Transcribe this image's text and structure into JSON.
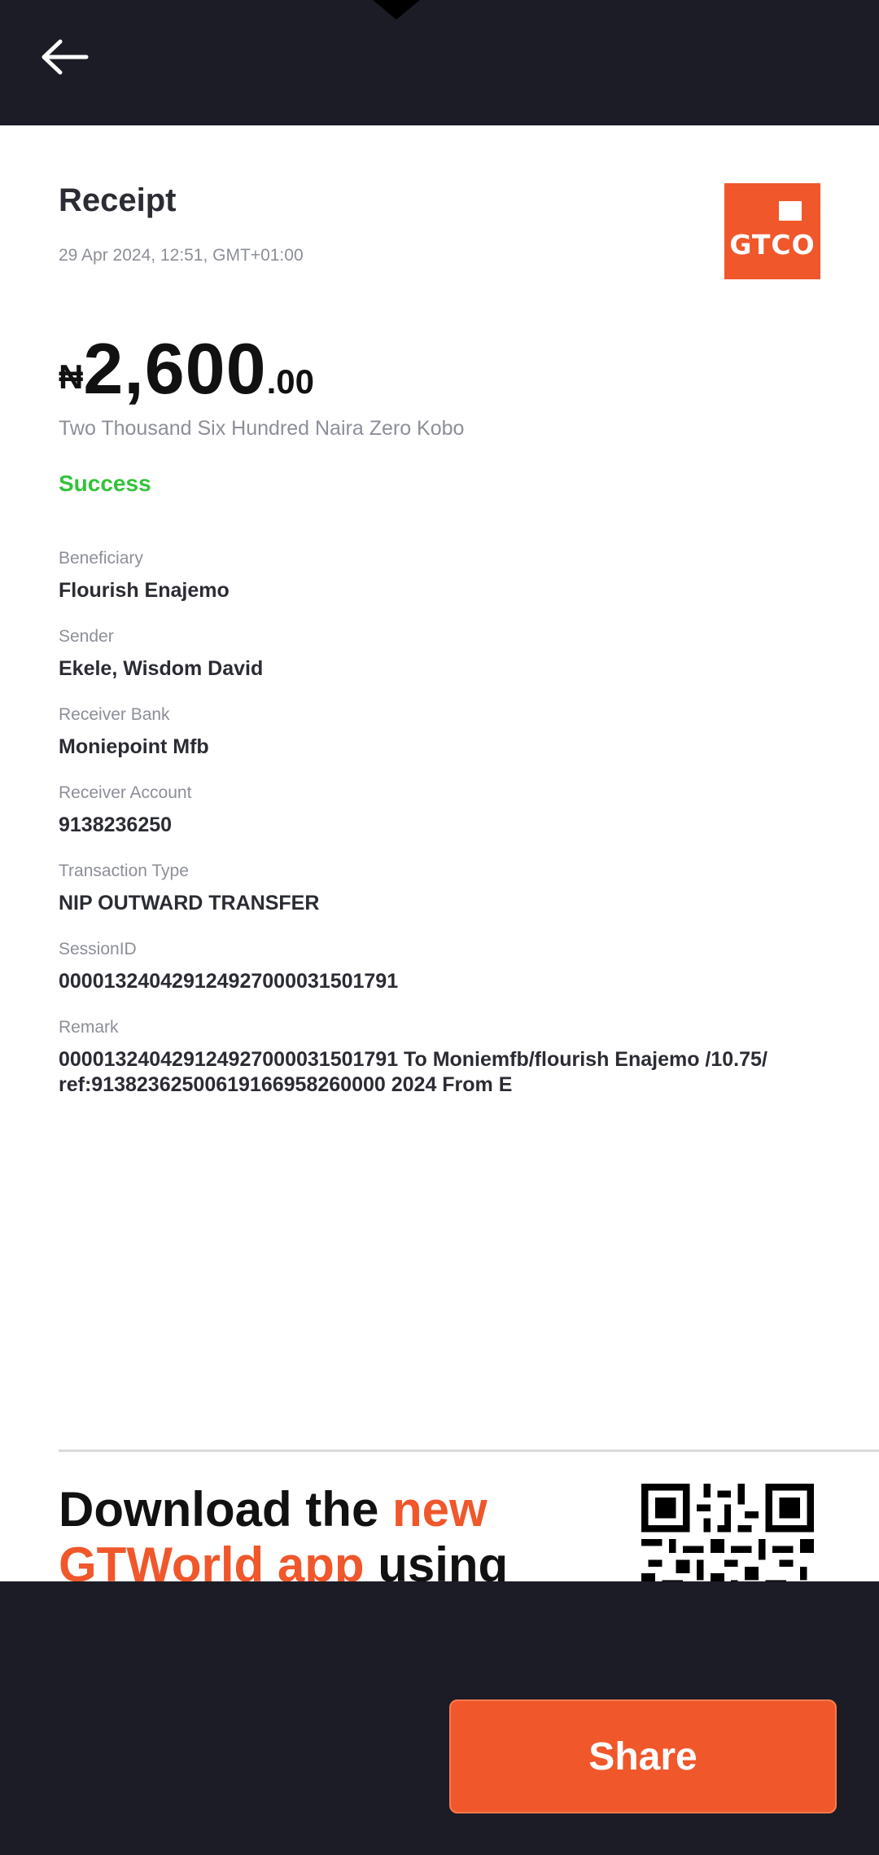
{
  "header": {
    "back_icon": "arrow-left-icon"
  },
  "receipt": {
    "title": "Receipt",
    "datetime": "29 Apr 2024, 12:51, GMT+01:00",
    "logo_text": "GTCO",
    "currency_symbol": "₦",
    "amount_whole": "2,600",
    "amount_decimal": ".00",
    "amount_words": "Two Thousand Six Hundred Naira Zero Kobo",
    "status": "Success",
    "fields": [
      {
        "label": "Beneficiary",
        "value": "Flourish Enajemo"
      },
      {
        "label": "Sender",
        "value": "Ekele, Wisdom David"
      },
      {
        "label": "Receiver Bank",
        "value": "Moniepoint Mfb"
      },
      {
        "label": "Receiver Account",
        "value": "9138236250"
      },
      {
        "label": "Transaction Type",
        "value": "NIP OUTWARD TRANSFER"
      },
      {
        "label": "SessionID",
        "value": "000013240429124927000031501791"
      },
      {
        "label": "Remark",
        "value": "000013240429124927000031501791 To Moniemfb/flourish Enajemo /10.75/ ref:91382362500619166958260000 2024 From E"
      }
    ],
    "promo": {
      "part1": "Download the ",
      "part2": "new GTWorld app",
      "part3": " using"
    }
  },
  "footer": {
    "share_label": "Share"
  },
  "colors": {
    "brand_orange": "#f0572b",
    "success_green": "#34c23a",
    "dark_bg": "#1b1c26"
  }
}
